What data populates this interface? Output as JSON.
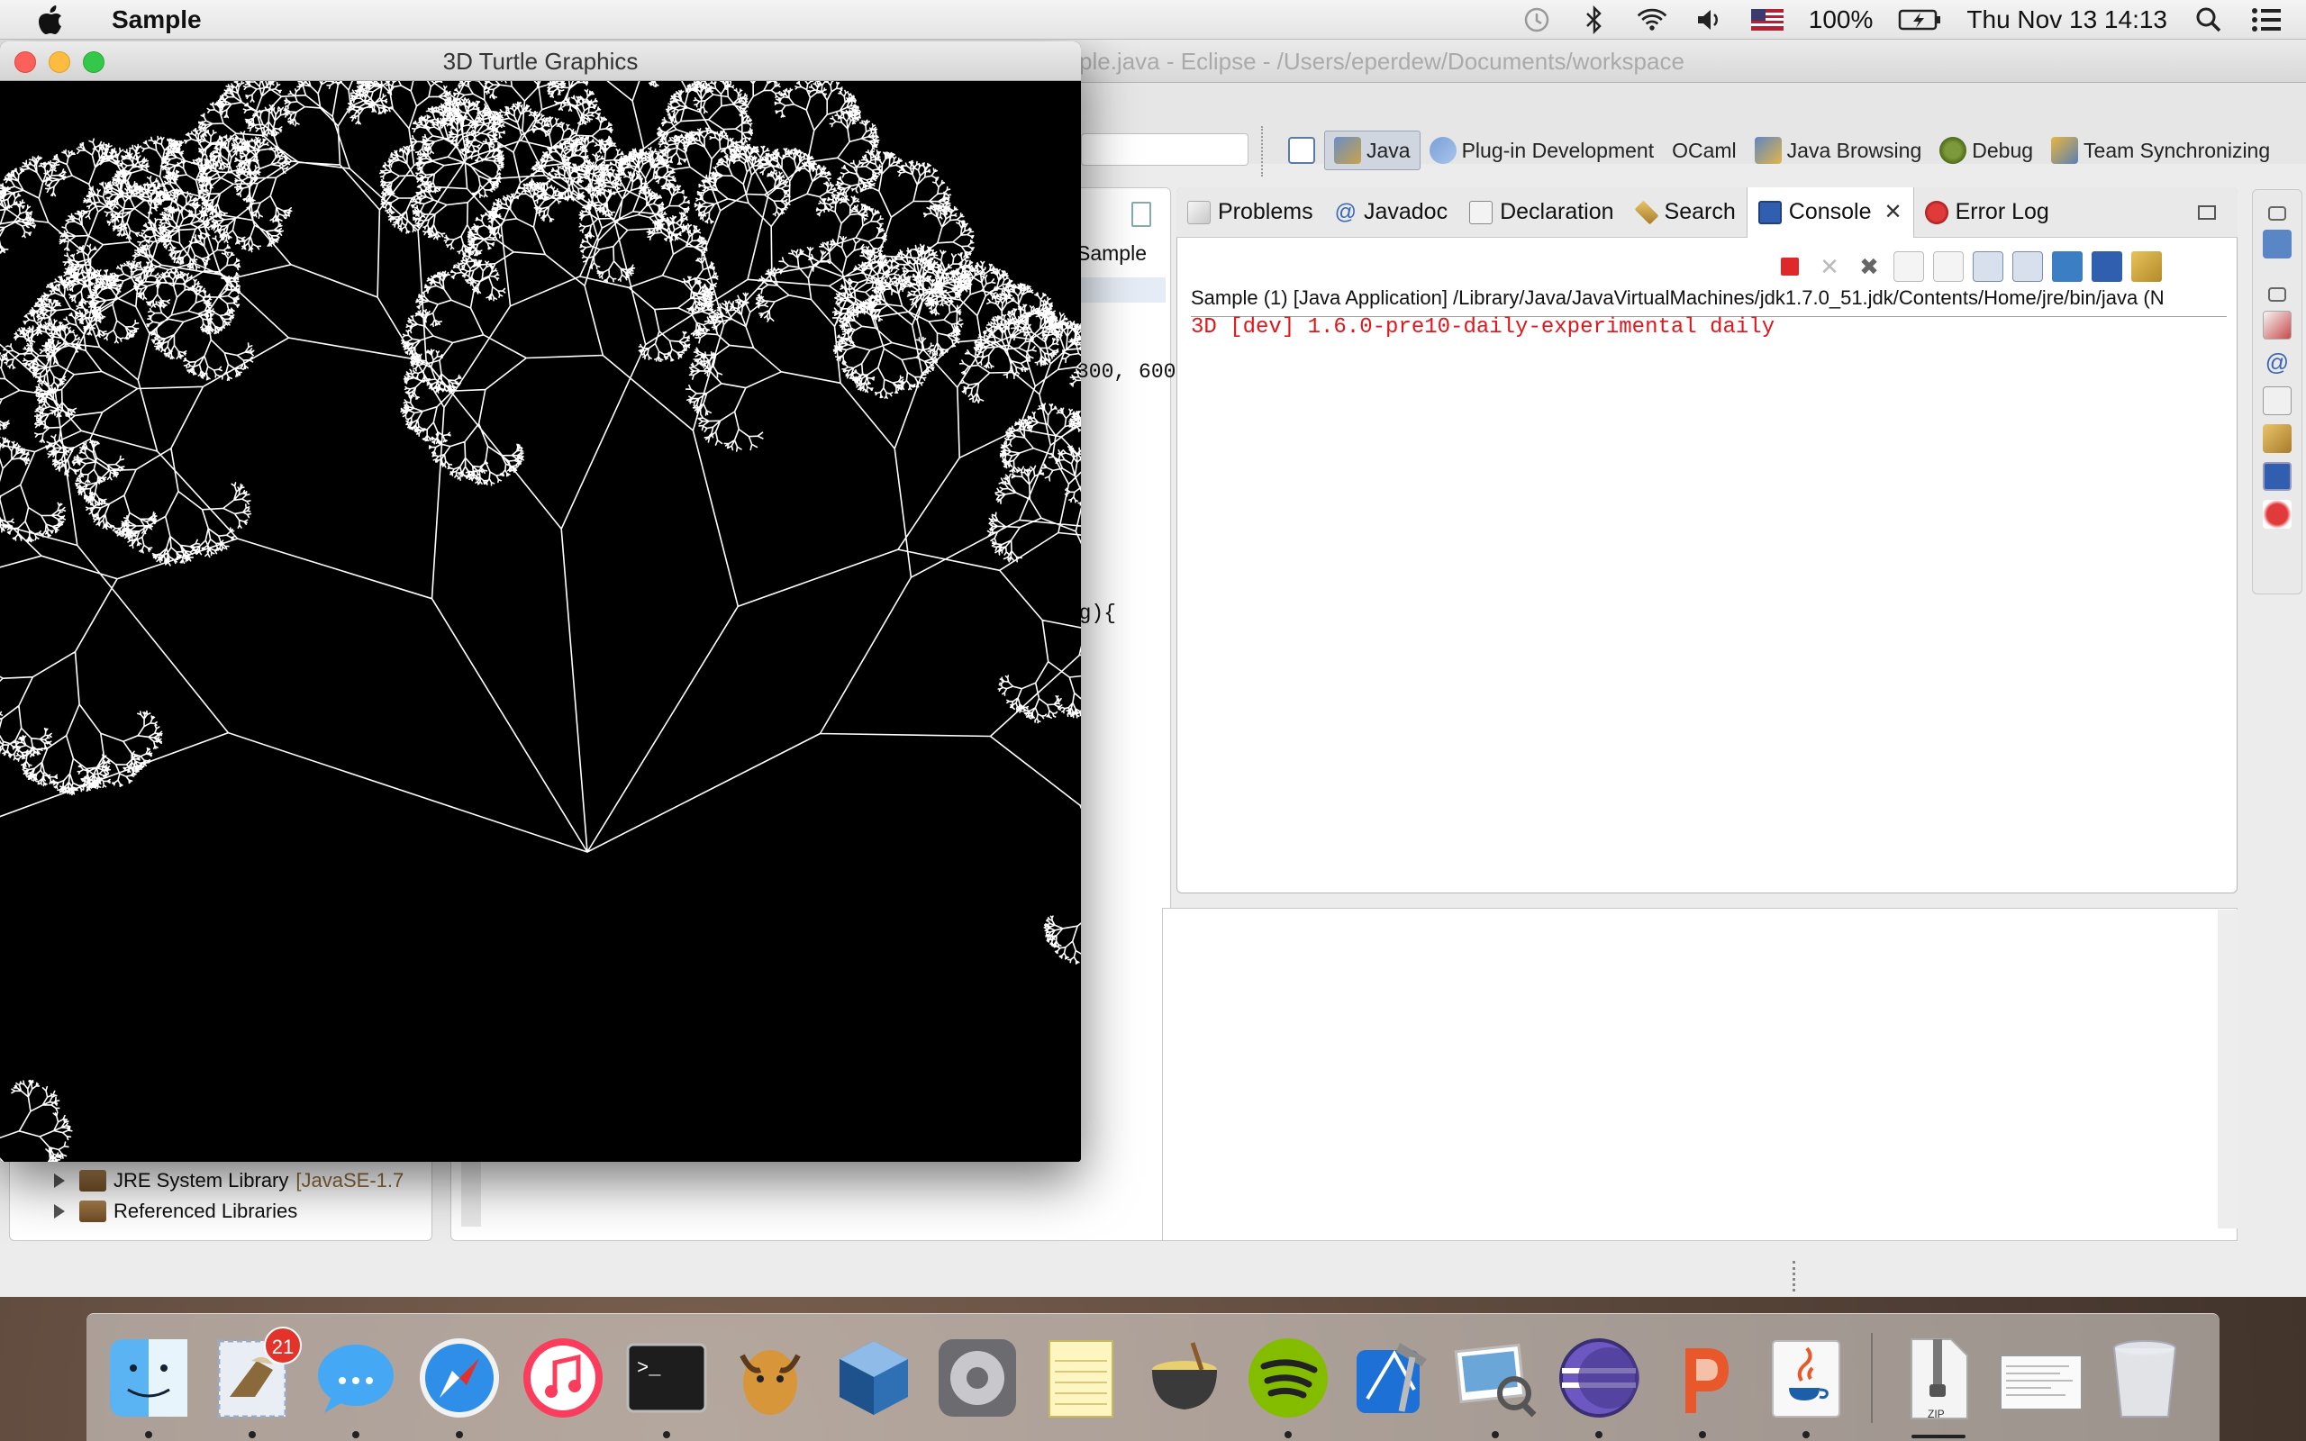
{
  "menubar": {
    "app_name": "Sample",
    "battery": "100%",
    "clock": "Thu Nov 13  14:13",
    "icons": [
      "apple-icon",
      "time-machine-icon",
      "bluetooth-icon",
      "wifi-icon",
      "volume-icon",
      "us-flag-icon",
      "battery-charging-icon",
      "spotlight-icon",
      "notification-center-icon"
    ]
  },
  "eclipse": {
    "title": "Sample.java - Eclipse - /Users/eperdew/Documents/workspace",
    "title_visible": "ple.java - Eclipse - /Users/eperdew/Documents/workspace",
    "perspectives": [
      {
        "label": "Java",
        "active": true
      },
      {
        "label": "Plug-in Development",
        "active": false
      },
      {
        "label": "OCaml",
        "active": false
      },
      {
        "label": "Java Browsing",
        "active": false
      },
      {
        "label": "Debug",
        "active": false
      },
      {
        "label": "Team Synchronizing",
        "active": false
      }
    ],
    "editor": {
      "tab_label": "Sample",
      "visible_fragment_1": "300, 600",
      "visible_fragment_2": "arg){"
    },
    "package_explorer": {
      "items": [
        {
          "label": "JRE System Library",
          "suffix": "[JavaSE-1.7"
        },
        {
          "label": "Referenced Libraries",
          "suffix": ""
        }
      ]
    },
    "console": {
      "tabs": [
        {
          "label": "Problems",
          "active": false
        },
        {
          "label": "Javadoc",
          "active": false
        },
        {
          "label": "Declaration",
          "active": false
        },
        {
          "label": "Search",
          "active": false
        },
        {
          "label": "Console",
          "active": true
        },
        {
          "label": "Error Log",
          "active": false
        }
      ],
      "header": "Sample (1) [Java Application] /Library/Java/JavaVirtualMachines/jdk1.7.0_51.jdk/Contents/Home/jre/bin/java (N",
      "output": "3D [dev] 1.6.0-pre10-daily-experimental daily"
    }
  },
  "turtle_window": {
    "title": "3D Turtle Graphics"
  },
  "dock": {
    "items": [
      {
        "name": "finder",
        "running": true
      },
      {
        "name": "mail",
        "badge": "21",
        "running": true
      },
      {
        "name": "messages",
        "running": true
      },
      {
        "name": "safari",
        "running": true
      },
      {
        "name": "itunes",
        "running": false
      },
      {
        "name": "terminal",
        "running": true
      },
      {
        "name": "gnu",
        "running": false
      },
      {
        "name": "virtualbox",
        "running": false
      },
      {
        "name": "system-preferences",
        "running": false
      },
      {
        "name": "notes",
        "running": false
      },
      {
        "name": "cauldron",
        "running": false
      },
      {
        "name": "spotify",
        "running": true
      },
      {
        "name": "xcode",
        "running": false
      },
      {
        "name": "preview",
        "running": true
      },
      {
        "name": "eclipse",
        "running": true
      },
      {
        "name": "powerpoint",
        "running": true
      },
      {
        "name": "java",
        "running": true
      }
    ],
    "stack_items": [
      {
        "name": "zip-archive",
        "label": "ZIP"
      },
      {
        "name": "downloads-stack"
      },
      {
        "name": "trash"
      }
    ]
  }
}
